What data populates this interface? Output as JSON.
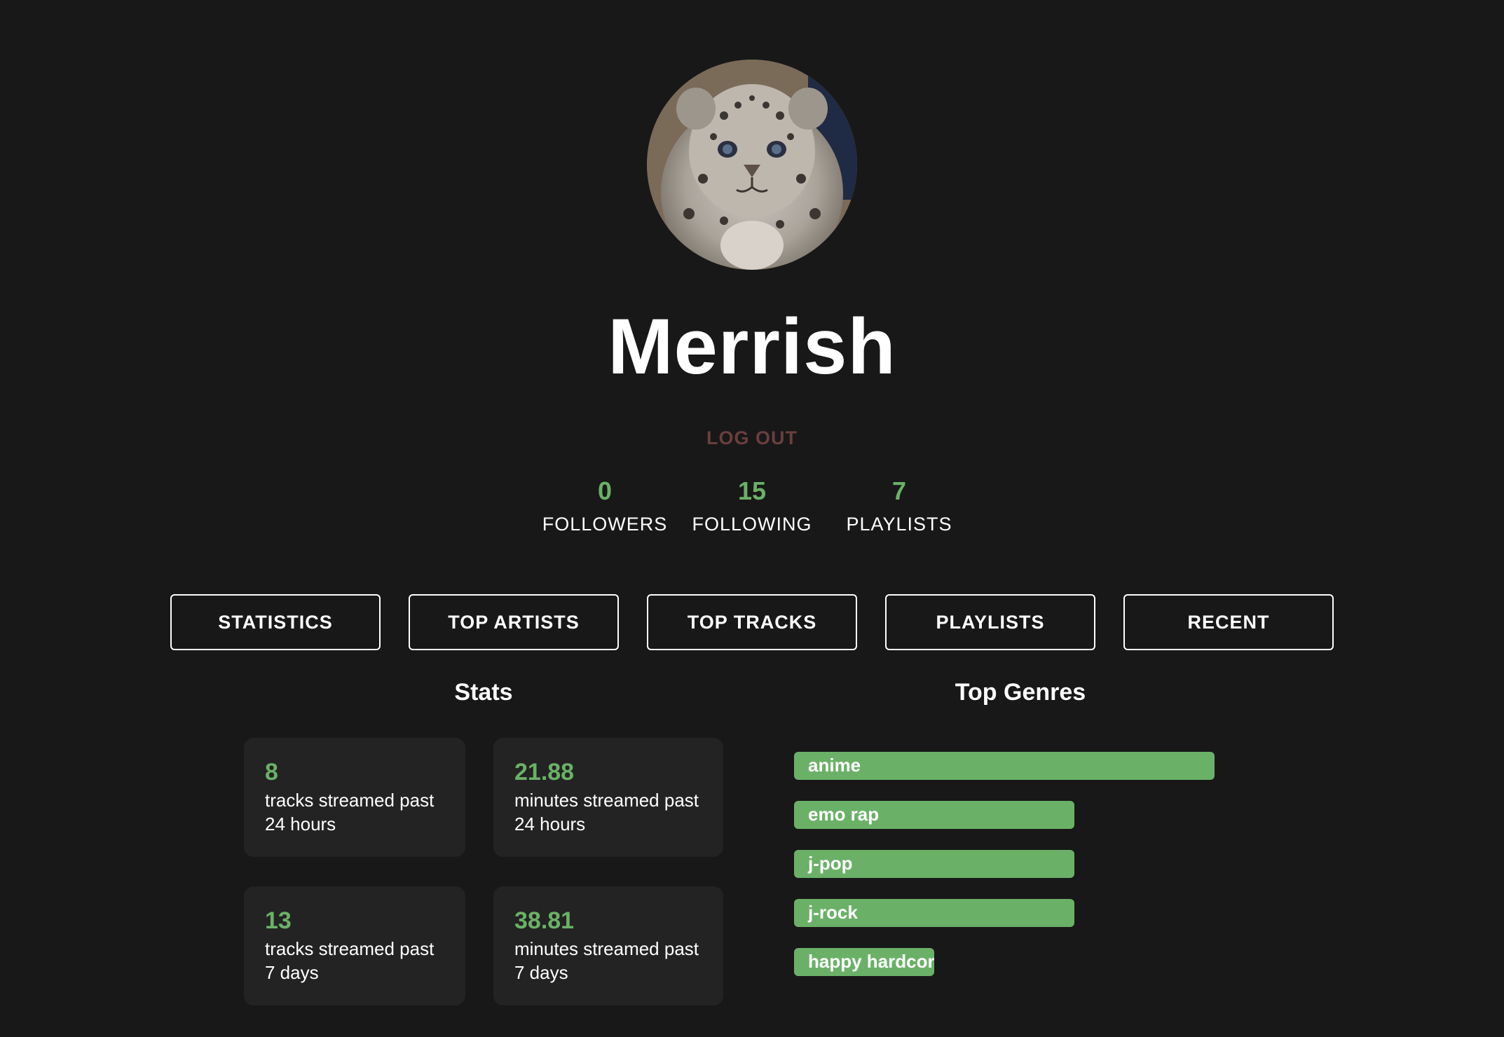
{
  "profile": {
    "username": "Merrish",
    "logout_label": "LOG OUT"
  },
  "counts": [
    {
      "value": "0",
      "label": "FOLLOWERS"
    },
    {
      "value": "15",
      "label": "FOLLOWING"
    },
    {
      "value": "7",
      "label": "PLAYLISTS"
    }
  ],
  "nav": [
    {
      "label": "STATISTICS"
    },
    {
      "label": "TOP ARTISTS"
    },
    {
      "label": "TOP TRACKS"
    },
    {
      "label": "PLAYLISTS"
    },
    {
      "label": "RECENT"
    }
  ],
  "stats": {
    "title": "Stats",
    "cards": [
      {
        "value": "8",
        "description": "tracks streamed past\n24 hours"
      },
      {
        "value": "21.88",
        "description": "minutes streamed past\n24 hours"
      },
      {
        "value": "13",
        "description": "tracks streamed past\n7 days"
      },
      {
        "value": "38.81",
        "description": "minutes streamed past\n7 days"
      }
    ]
  },
  "genres": {
    "title": "Top Genres",
    "items": [
      {
        "label": "anime",
        "share": 1.0
      },
      {
        "label": "emo rap",
        "share": 0.667
      },
      {
        "label": "j-pop",
        "share": 0.667
      },
      {
        "label": "j-rock",
        "share": 0.667
      },
      {
        "label": "happy hardcore",
        "share": 0.333
      }
    ]
  },
  "colors": {
    "background": "#181818",
    "accent": "#6ab167",
    "card": "#232323",
    "logout": "#6b3e3e"
  }
}
